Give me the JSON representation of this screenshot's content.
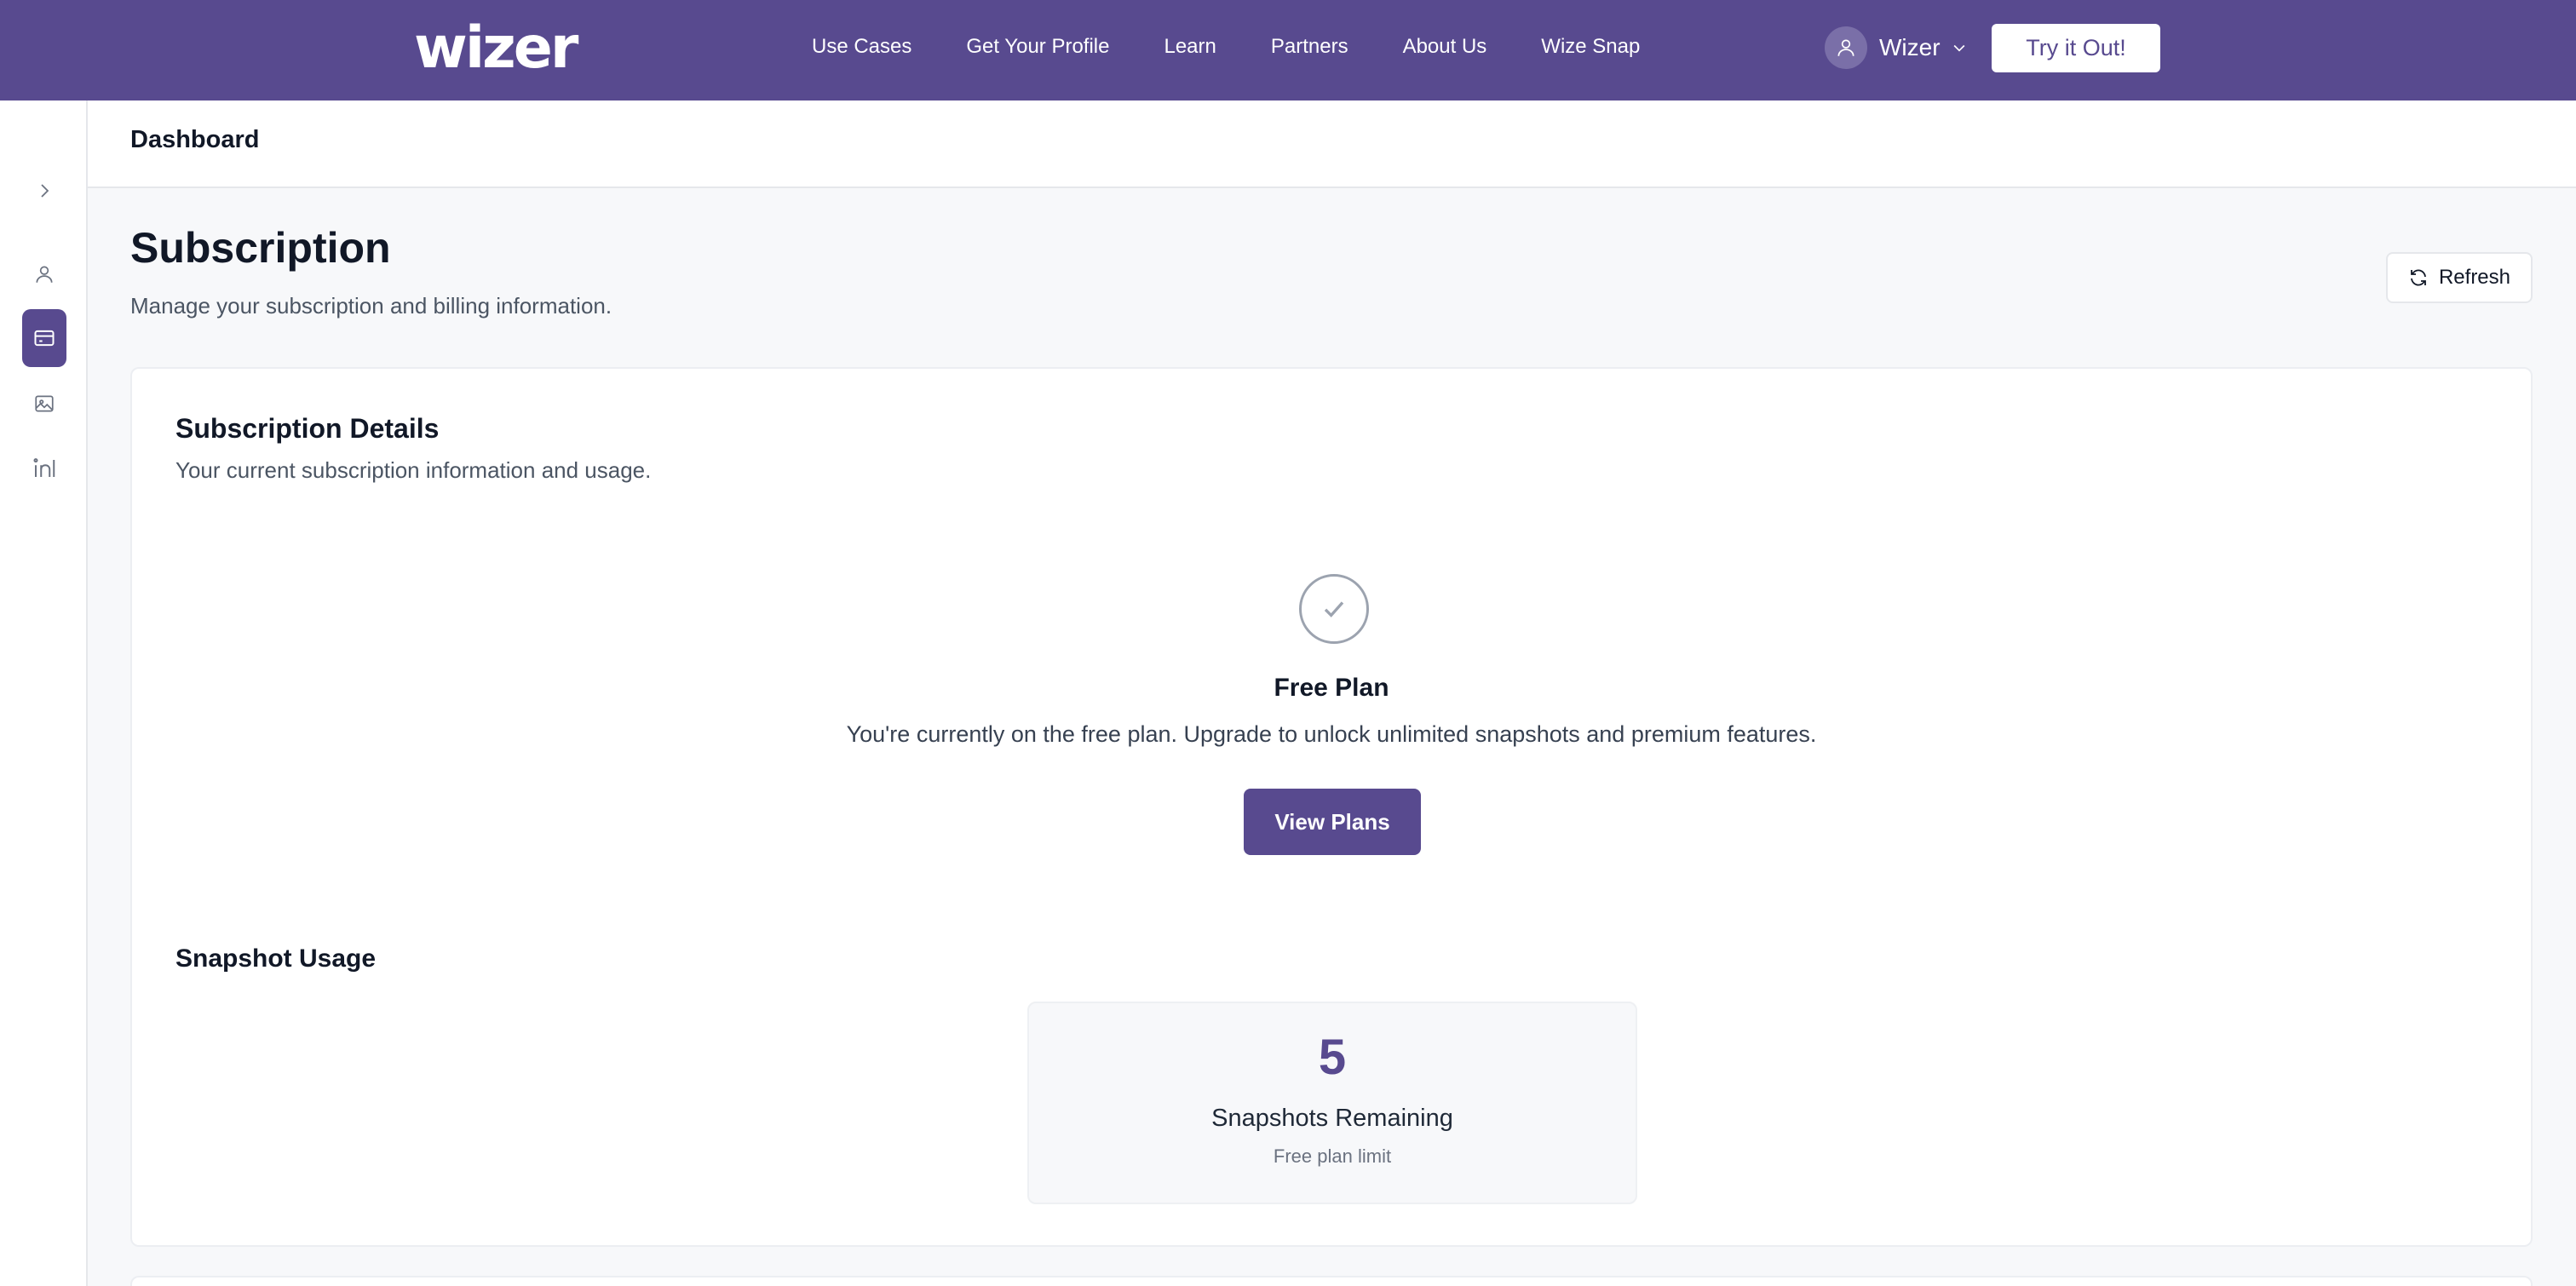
{
  "nav": {
    "logo": "wizer",
    "links": [
      "Use Cases",
      "Get Your Profile",
      "Learn",
      "Partners",
      "About Us",
      "Wize Snap"
    ],
    "user_name": "Wizer",
    "cta": "Try it Out!"
  },
  "sidebar": {
    "items": [
      {
        "icon": "chevron-right-icon",
        "active": false
      },
      {
        "icon": "user-icon",
        "active": false
      },
      {
        "icon": "credit-card-icon",
        "active": true
      },
      {
        "icon": "image-icon",
        "active": false
      },
      {
        "icon": "linkedin-icon",
        "active": false
      }
    ]
  },
  "header": {
    "title": "Dashboard"
  },
  "page": {
    "title": "Subscription",
    "subtitle": "Manage your subscription and billing information.",
    "refresh_label": "Refresh"
  },
  "subscription": {
    "title": "Subscription Details",
    "subtitle": "Your current subscription information and usage.",
    "plan_name": "Free Plan",
    "plan_description": "You're currently on the free plan. Upgrade to unlock unlimited snapshots and premium features.",
    "cta": "View Plans"
  },
  "usage": {
    "title": "Snapshot Usage",
    "count": "5",
    "label": "Snapshots Remaining",
    "note": "Free plan limit"
  },
  "colors": {
    "brand": "#584a8f",
    "background": "#f7f8fa",
    "card": "#ffffff"
  }
}
